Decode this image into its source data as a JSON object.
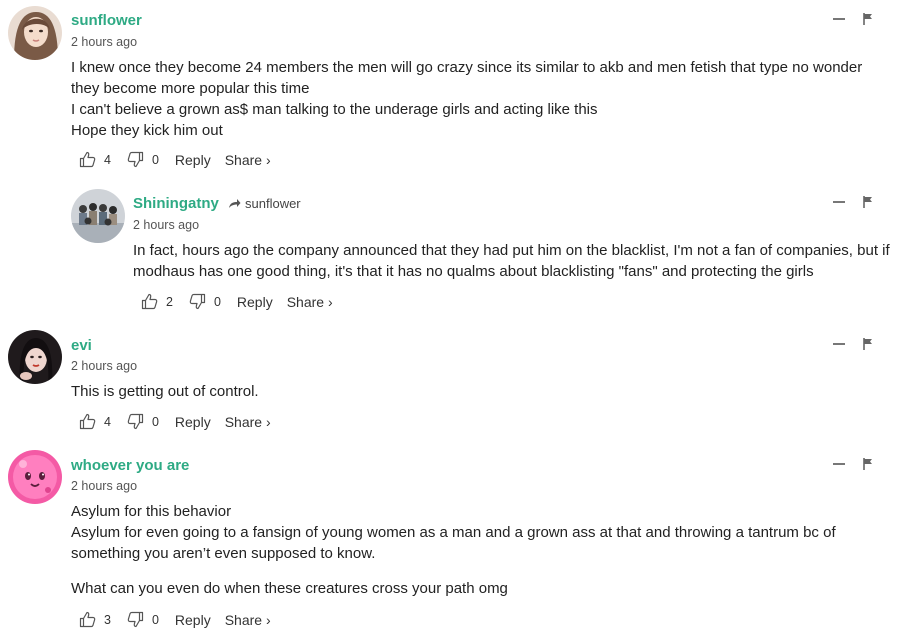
{
  "colors": {
    "username": "#2eaa84",
    "text": "#222222",
    "meta": "#555555"
  },
  "comments": [
    {
      "username": "sunflower",
      "timestamp": "2 hours ago",
      "lines": [
        "I knew once they become 24 members the men will go crazy since its similar to akb and men fetish that type no wonder they become more popular this time",
        "I can't believe a grown as$ man talking to the underage girls and acting like this",
        "Hope they kick him out"
      ],
      "upvotes": "4",
      "downvotes": "0",
      "reply_label": "Reply",
      "share_label": "Share ›"
    },
    {
      "username": "Shiningatny",
      "reply_to": "sunflower",
      "timestamp": "2 hours ago",
      "lines": [
        "In fact, hours ago the company announced that they had put him on the blacklist, I'm not a fan of companies, but if modhaus has one good thing, it's that it has no qualms about blacklisting \"fans\" and protecting the girls"
      ],
      "upvotes": "2",
      "downvotes": "0",
      "reply_label": "Reply",
      "share_label": "Share ›"
    },
    {
      "username": "evi",
      "timestamp": "2 hours ago",
      "lines": [
        "This is getting out of control."
      ],
      "upvotes": "4",
      "downvotes": "0",
      "reply_label": "Reply",
      "share_label": "Share ›"
    },
    {
      "username": "whoever you are",
      "timestamp": "2 hours ago",
      "lines": [
        "Asylum for this behavior",
        "Asylum for even going to a fansign of young women as a man and a grown ass at that and throwing a tantrum bc of something you aren’t even supposed to know.",
        "",
        "What can you even do when these creatures cross your path omg"
      ],
      "upvotes": "3",
      "downvotes": "0",
      "reply_label": "Reply",
      "share_label": "Share ›"
    }
  ]
}
